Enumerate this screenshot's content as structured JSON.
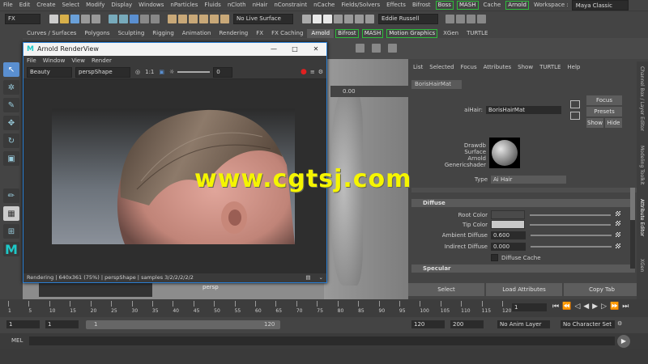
{
  "menubar": {
    "items": [
      "File",
      "Edit",
      "Create",
      "Select",
      "Modify",
      "Display",
      "Windows",
      "nParticles",
      "Fluids",
      "nCloth",
      "nHair",
      "nConstraint",
      "nCache",
      "Fields/Solvers",
      "Effects",
      "Bifrost"
    ],
    "badges": [
      "Boss",
      "MASH",
      "Arnold"
    ],
    "cache": "Cache",
    "workspace_label": "Workspace :",
    "workspace_value": "Maya Classic"
  },
  "toolbar": {
    "mode": "FX",
    "live_surface": "No Live Surface",
    "user": "Eddie Russell"
  },
  "shelf": {
    "tabs": [
      "Curves / Surfaces",
      "Polygons",
      "Sculpting",
      "Rigging",
      "Animation",
      "Rendering",
      "FX",
      "FX Caching",
      "Arnold",
      "Bifrost",
      "MASH",
      "Motion Graphics",
      "XGen",
      "TURTLE"
    ],
    "active": "Arnold"
  },
  "renderview": {
    "title": "Arnold RenderView",
    "menu": [
      "File",
      "Window",
      "View",
      "Render"
    ],
    "aov": "Beauty",
    "camera": "perspShape",
    "ratio": "1:1",
    "exposure": "0",
    "status": "Rendering | 640x361 (75%) | perspShape | samples 3/2/2/2/2/2"
  },
  "viewport": {
    "camera_label": "persp",
    "time_value": "0.00"
  },
  "watermark": "www.cgtsj.com",
  "attr_editor": {
    "menu": [
      "List",
      "Selected",
      "Focus",
      "Attributes",
      "Show",
      "TURTLE",
      "Help"
    ],
    "tab": "BorisHairMat",
    "name_label": "aiHair:",
    "name_value": "BorisHairMat",
    "focus": "Focus",
    "presets": "Presets",
    "show": "Show",
    "hide": "Hide",
    "classification": [
      "Drawdb",
      "Surface",
      "Arnold",
      "Genericshader"
    ],
    "type_label": "Type",
    "type_value": "Ai Hair",
    "section_diffuse": "Diffuse",
    "section_specular": "Specular",
    "root_color": "Root Color",
    "tip_color": "Tip Color",
    "ambient_label": "Ambient Diffuse",
    "ambient_value": "0.600",
    "indirect_label": "Indirect Diffuse",
    "indirect_value": "0.000",
    "diffuse_cache": "Diffuse Cache",
    "select_btn": "Select",
    "load_btn": "Load Attributes",
    "copy_btn": "Copy Tab"
  },
  "sidebar_tabs": [
    "Channel Box / Layer Editor",
    "Modeling Toolkit",
    "Attribute Editor",
    "XGen"
  ],
  "timeline": {
    "ticks": [
      "1",
      "5",
      "10",
      "15",
      "20",
      "25",
      "30",
      "35",
      "40",
      "45",
      "50",
      "55",
      "60",
      "65",
      "70",
      "75",
      "80",
      "85",
      "90",
      "95",
      "100",
      "105",
      "110",
      "115",
      "120"
    ],
    "current_frame": "1"
  },
  "range": {
    "start": "1",
    "start2": "1",
    "inner_start": "1",
    "inner_end": "120",
    "end": "120",
    "end2": "200",
    "anim_layer": "No Anim Layer",
    "char_set": "No Character Set"
  },
  "mel": {
    "label": "MEL"
  },
  "colors": {
    "accent": "#2a7fd4",
    "badge_border": "#2dbb3a",
    "watermark": "#f5f500"
  }
}
